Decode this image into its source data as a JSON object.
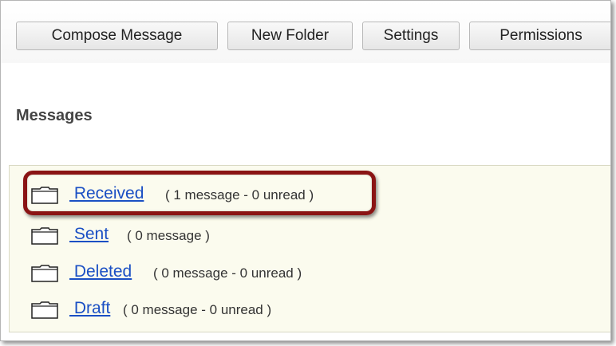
{
  "toolbar": {
    "buttons": [
      {
        "label": "Compose Message"
      },
      {
        "label": "New Folder"
      },
      {
        "label": "Settings"
      },
      {
        "label": "Permissions"
      }
    ]
  },
  "page": {
    "title": "Messages"
  },
  "folders": [
    {
      "name": " Received",
      "count": "( 1 message - 0 unread )",
      "icon": "folder-icon",
      "highlighted": true
    },
    {
      "name": " Sent",
      "count": "( 0 message )",
      "icon": "folder-icon",
      "highlighted": false
    },
    {
      "name": " Deleted",
      "count": "( 0 message - 0 unread )",
      "icon": "folder-icon",
      "highlighted": false
    },
    {
      "name": " Draft",
      "count": "( 0 message - 0 unread )",
      "icon": "folder-icon",
      "highlighted": false
    }
  ],
  "colors": {
    "link": "#1a4fc4",
    "panel": "#fbfbee",
    "highlight": "#8a1414"
  }
}
